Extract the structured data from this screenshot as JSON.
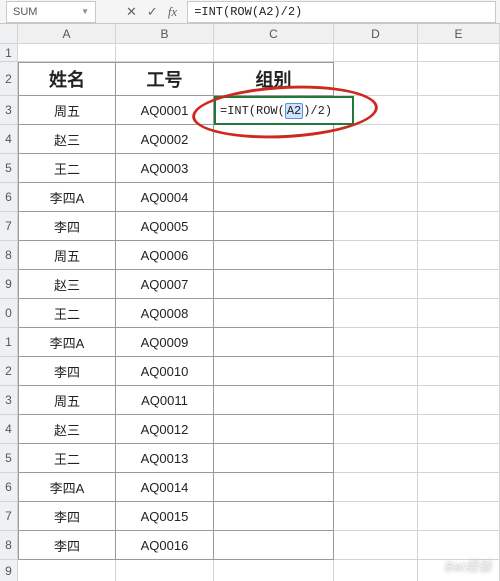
{
  "chart_data": {
    "type": "table",
    "title": "",
    "columns": [
      "姓名",
      "工号",
      "组别"
    ],
    "rows": [
      [
        "周五",
        "AQ0001",
        "=INT(ROW(A2)/2)"
      ],
      [
        "赵三",
        "AQ0002",
        ""
      ],
      [
        "王二",
        "AQ0003",
        ""
      ],
      [
        "李四A",
        "AQ0004",
        ""
      ],
      [
        "李四",
        "AQ0005",
        ""
      ],
      [
        "周五",
        "AQ0006",
        ""
      ],
      [
        "赵三",
        "AQ0007",
        ""
      ],
      [
        "王二",
        "AQ0008",
        ""
      ],
      [
        "李四A",
        "AQ0009",
        ""
      ],
      [
        "李四",
        "AQ0010",
        ""
      ],
      [
        "周五",
        "AQ0011",
        ""
      ],
      [
        "赵三",
        "AQ0012",
        ""
      ],
      [
        "王二",
        "AQ0013",
        ""
      ],
      [
        "李四A",
        "AQ0014",
        ""
      ],
      [
        "李四",
        "AQ0015",
        ""
      ],
      [
        "李四",
        "AQ0016",
        ""
      ]
    ]
  },
  "formula_bar": {
    "name_box": "SUM",
    "cancel_icon": "✕",
    "confirm_icon": "✓",
    "fx_icon": "fx",
    "formula_text": "=INT(ROW(A2)/2)"
  },
  "grid": {
    "columns": [
      "A",
      "B",
      "C",
      "D",
      "E"
    ],
    "row_labels": [
      "1",
      "2",
      "3",
      "4",
      "5",
      "6",
      "7",
      "8",
      "9",
      "0",
      "1",
      "2",
      "3",
      "4",
      "5",
      "6",
      "7",
      "8",
      "9"
    ]
  },
  "active_cell": {
    "address": "C3",
    "display_parts": {
      "pre": "=INT(ROW(",
      "ref": "A2",
      "post": ")/2)"
    }
  },
  "watermark": {
    "main": "Bai",
    "accent": "经验",
    "sub": ""
  }
}
